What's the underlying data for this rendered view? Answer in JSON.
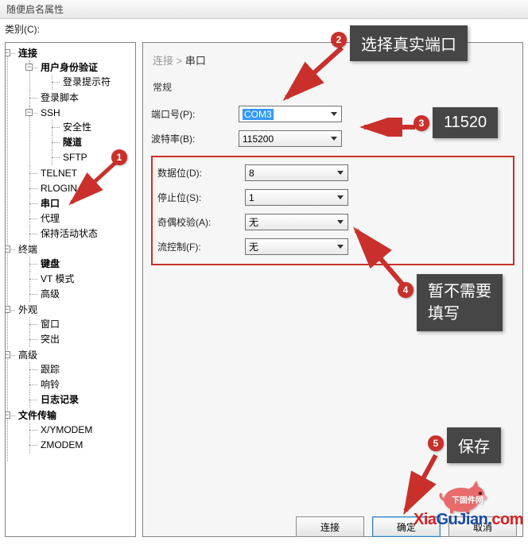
{
  "window": {
    "title": "随便启名属性"
  },
  "category_label": "类别(C):",
  "tree": {
    "root": "连接",
    "user_auth": "用户身份验证",
    "login_prompt": "登录提示符",
    "login_script": "登录脚本",
    "ssh": "SSH",
    "security": "安全性",
    "tunnel": "隧道",
    "sftp": "SFTP",
    "telnet": "TELNET",
    "rlogin": "RLOGIN",
    "serial": "串口",
    "proxy": "代理",
    "keep_active": "保持活动状态",
    "terminal": "终端",
    "keyboard": "键盘",
    "vt_mode": "VT 模式",
    "advanced_term": "高级",
    "appearance": "外观",
    "window": "窗口",
    "highlight": "突出",
    "advanced": "高级",
    "trace": "跟踪",
    "bell": "响铃",
    "logging": "日志记录",
    "file_transfer": "文件传输",
    "xymodem": "X/YMODEM",
    "zmodem": "ZMODEM"
  },
  "breadcrumb": {
    "parent": "连接",
    "sep": " > ",
    "current": "串口"
  },
  "section": "常规",
  "fields": {
    "port_label": "端口号(P):",
    "port_value": "COM3",
    "baud_label": "波特率(B):",
    "baud_value": "115200",
    "data_label": "数据位(D):",
    "data_value": "8",
    "stop_label": "停止位(S):",
    "stop_value": "1",
    "parity_label": "奇偶校验(A):",
    "parity_value": "无",
    "flow_label": "流控制(F):",
    "flow_value": "无"
  },
  "annotations": {
    "n1": "1",
    "n2": "2",
    "n3": "3",
    "n4": "4",
    "n5": "5",
    "t2": "选择真实端口",
    "t3": "11520",
    "t4a": "暂不需要",
    "t4b": "填写",
    "t5": "保存"
  },
  "buttons": {
    "connect": "连接",
    "ok": "确定",
    "cancel": "取消"
  },
  "watermark": {
    "pig_text": "下固件网",
    "xia": "Xia",
    "gujian": "GuJian",
    "dot": ".",
    "com": "com"
  }
}
